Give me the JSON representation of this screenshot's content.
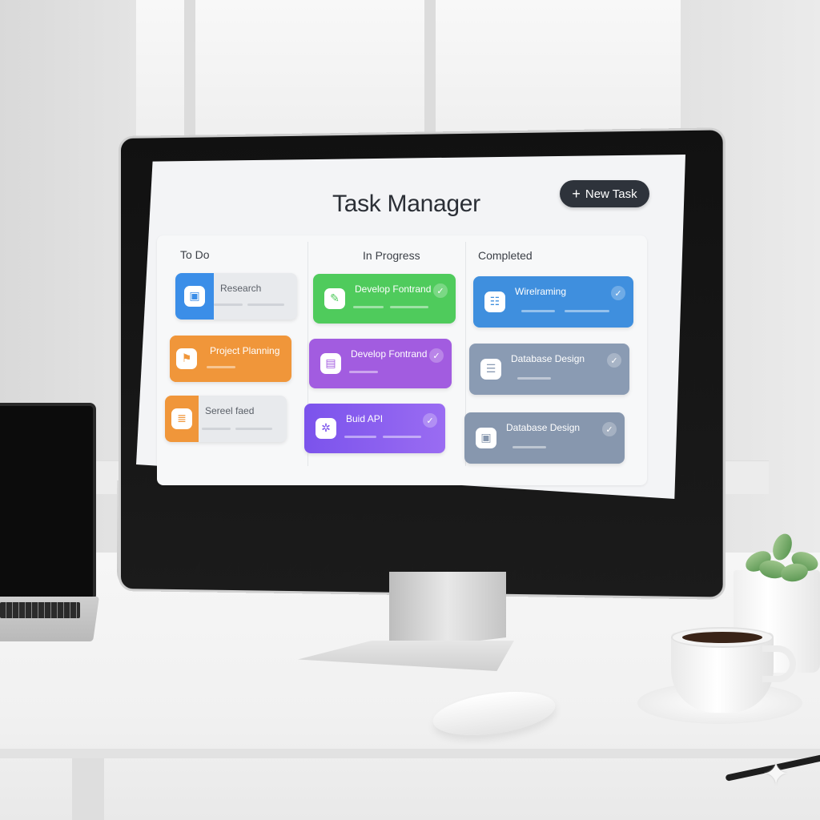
{
  "app": {
    "title": "Task Manager",
    "new_task_label": "New Task",
    "new_task_icon": "plus-icon"
  },
  "columns": [
    {
      "id": "todo",
      "label": "To Do",
      "cards": [
        {
          "title": "Research",
          "icon": "image-icon",
          "color": "#3b8ee8",
          "style": "accent"
        },
        {
          "title": "Project Planning",
          "icon": "flag-icon",
          "color": "#f0963a",
          "style": "solid"
        },
        {
          "title": "Sereel faed",
          "icon": "list-icon",
          "color": "#f0963a",
          "style": "accent"
        }
      ]
    },
    {
      "id": "in-progress",
      "label": "In Progress",
      "cards": [
        {
          "title": "Develop Fontrand",
          "icon": "edit-icon",
          "color": "#4fcb5c",
          "style": "solid",
          "checked": true
        },
        {
          "title": "Develop Fontrand",
          "icon": "document-icon",
          "color": "#a25ce0",
          "style": "solid",
          "checked": true
        },
        {
          "title": "Buid API",
          "icon": "gear-icon",
          "color": "#8a5df0",
          "style": "solid",
          "checked": true
        }
      ]
    },
    {
      "id": "completed",
      "label": "Completed",
      "cards": [
        {
          "title": "Wirelraming",
          "icon": "layout-icon",
          "color": "#3f8fde",
          "style": "solid",
          "checked": true
        },
        {
          "title": "Database Design",
          "icon": "database-icon",
          "color": "#8a9bb3",
          "style": "solid",
          "checked": true
        },
        {
          "title": "Database Design",
          "icon": "image-icon",
          "color": "#8797ae",
          "style": "solid",
          "checked": true
        }
      ]
    }
  ],
  "icons": {
    "check": "check-icon",
    "apple": "apple-logo"
  }
}
